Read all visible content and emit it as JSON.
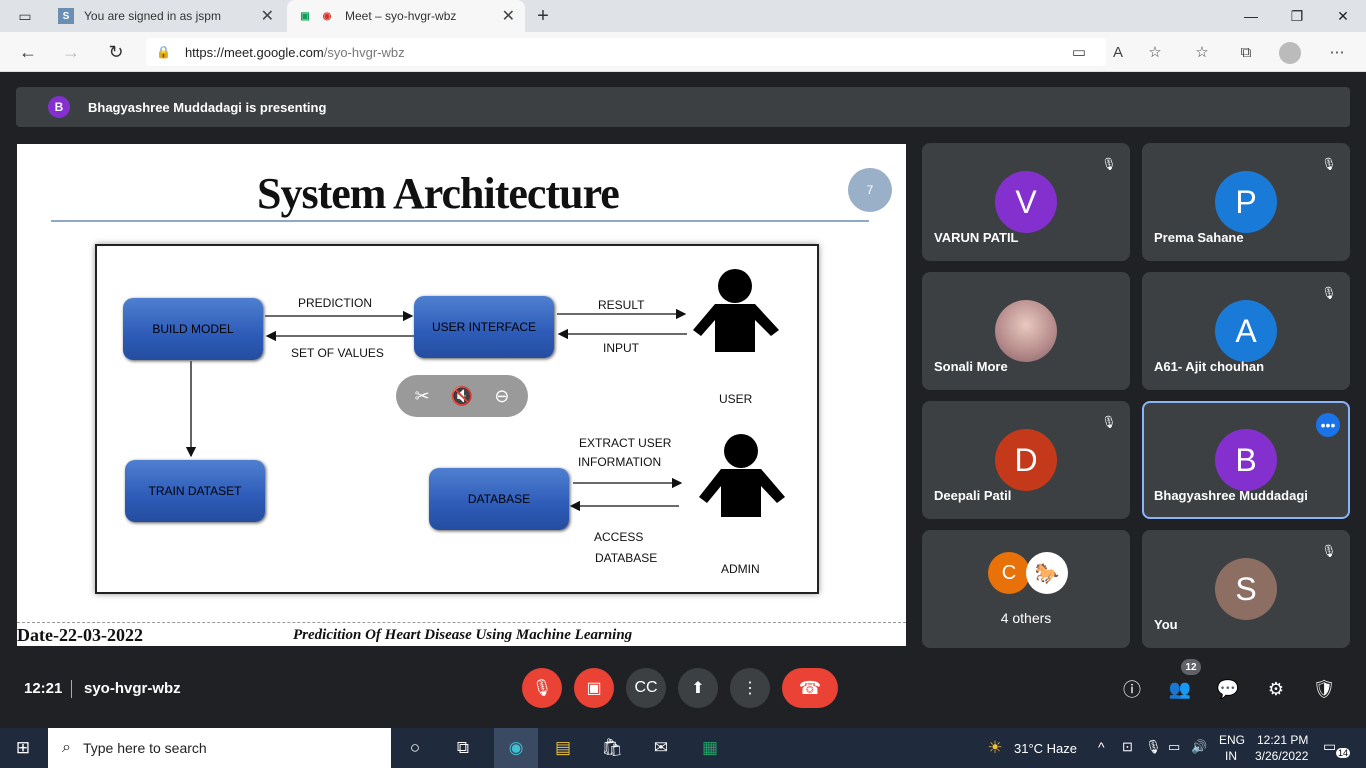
{
  "browser": {
    "tabs": [
      {
        "favicon": "S",
        "label": "You are signed in as jspm"
      },
      {
        "favicon": "meet-icon",
        "label": "Meet – syo-hvgr-wbz"
      }
    ],
    "url_host": "https://meet.google.com",
    "url_path": "/syo-hvgr-wbz"
  },
  "meet": {
    "banner": {
      "avatar": "B",
      "text": "Bhagyashree Muddadagi is presenting"
    },
    "slide": {
      "title": "System Architecture",
      "page": "7",
      "date": "Date-22-03-2022",
      "footer": "Predicition Of Heart Disease Using Machine Learning",
      "diagram": {
        "build_model": "BUILD MODEL",
        "user_interface": "USER INTERFACE",
        "train_dataset": "TRAIN DATASET",
        "database": "DATABASE",
        "prediction": "PREDICTION",
        "set_of_values": "SET OF VALUES",
        "result": "RESULT",
        "input": "INPUT",
        "user": "USER",
        "extract1": "EXTRACT USER",
        "extract2": "INFORMATION",
        "access1": "ACCESS",
        "access2": "DATABASE",
        "admin": "ADMIN"
      }
    },
    "participants": [
      {
        "initial": "V",
        "name": "VARUN PATIL",
        "color": "#8430ce"
      },
      {
        "initial": "P",
        "name": "Prema Sahane",
        "color": "#1a7ad8"
      },
      {
        "initial": "",
        "name": "Sonali More",
        "color": "#c9a7a7"
      },
      {
        "initial": "A",
        "name": "A61- Ajit chouhan",
        "color": "#1a7ad8"
      },
      {
        "initial": "D",
        "name": "Deepali Patil",
        "color": "#c5391b"
      },
      {
        "initial": "B",
        "name": "Bhagyashree Muddadagi",
        "color": "#8430ce"
      },
      {
        "initial": "C",
        "name": "4 others",
        "color": "#e8710a"
      },
      {
        "initial": "S",
        "name": "You",
        "color": "#8d6e63"
      }
    ],
    "bottom": {
      "time": "12:21",
      "meeting_code": "syo-hvgr-wbz",
      "people_count": "12"
    }
  },
  "taskbar": {
    "search_placeholder": "Type here to search",
    "weather": "31°C  Haze",
    "lang1": "ENG",
    "lang2": "IN",
    "time": "12:21 PM",
    "date": "3/26/2022",
    "notifications": "14"
  }
}
